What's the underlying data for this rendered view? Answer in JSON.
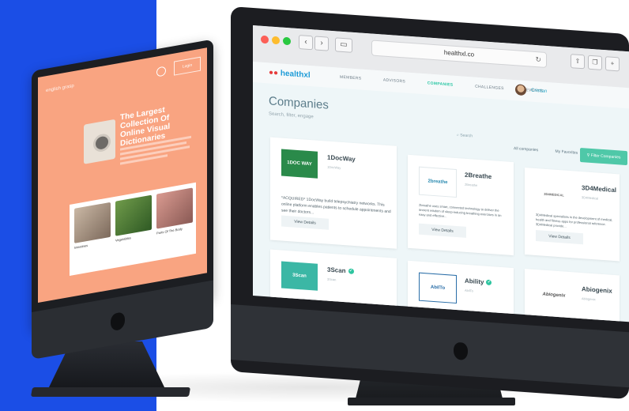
{
  "left_site": {
    "logo": "english grasp",
    "login_label": "Login",
    "hero_title": "The Largest Collection Of Online Visual Dictionaries",
    "cards": [
      {
        "caption": "Intestines"
      },
      {
        "caption": "Vegetables"
      },
      {
        "caption": "Parts Of The Body"
      }
    ]
  },
  "browser": {
    "url": "healthxl.co",
    "back_icon": "chevron-left-icon",
    "forward_icon": "chevron-right-icon"
  },
  "site": {
    "logo_text": "healthxl",
    "nav": [
      "MEMBERS",
      "ADVISORS",
      "COMPANIES",
      "CHALLENGES",
      "EVENTS"
    ],
    "active_nav": "COMPANIES",
    "user_name": "Cristian",
    "page_title": "Companies",
    "page_subtitle": "Search, filter, engage",
    "search_placeholder": "Search",
    "filter_all": "All companies",
    "filter_favorites": "My Favorites",
    "filter_button": "Filter Companies",
    "accent": "#4fc8a8"
  },
  "companies": [
    {
      "name": "1DocWay",
      "sub": "1DocWay",
      "logo": "1DOC WAY",
      "description": "*ACQUIRED* 1DocWay build telepsychiatry networks. This online platform enables patients to schedule appointments and see their doctors...",
      "button": "View Details"
    },
    {
      "name": "2Breathe",
      "sub": "2Breathe",
      "logo": "2breathe",
      "description": "2breathe uses smart, connected technology to deliver the ancient wisdom of sleep-inducing breathing exercises in an easy and effective...",
      "button": "View Details"
    },
    {
      "name": "3D4Medical",
      "sub": "3D4Medical",
      "logo": "3D4MEDICAL",
      "description": "3D4Medical specialises in the development of medical, health and fitness apps for professional reference. 3D4Medical provide...",
      "button": "View Details"
    },
    {
      "name": "3Scan",
      "sub": "3Scan",
      "logo": "3Scan"
    },
    {
      "name": "Ability",
      "sub": "AbilTo",
      "logo": "AbilTo"
    },
    {
      "name": "Abiogenix",
      "sub": "Abiogenix",
      "logo": "Abiogenix"
    }
  ]
}
